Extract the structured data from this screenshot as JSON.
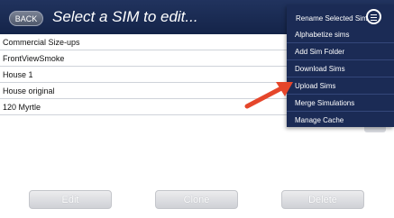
{
  "header": {
    "back_label": "BACK",
    "title": "Select a SIM to edit..."
  },
  "sims": [
    "Commercial Size-ups",
    "FrontViewSmoke",
    "House 1",
    "House original",
    "120 Myrtle"
  ],
  "menu": {
    "items": [
      "Rename Selected Sim",
      "Alphabetize sims",
      "Add Sim Folder",
      "Download Sims",
      "Upload Sims",
      "Merge Simulations",
      "Manage Cache"
    ]
  },
  "footer": {
    "edit_label": "Edit",
    "clone_label": "Clone",
    "delete_label": "Delete"
  },
  "colors": {
    "header_bg": "#1a2a52",
    "menu_bg": "#1b2b55",
    "arrow": "#e5462b"
  }
}
